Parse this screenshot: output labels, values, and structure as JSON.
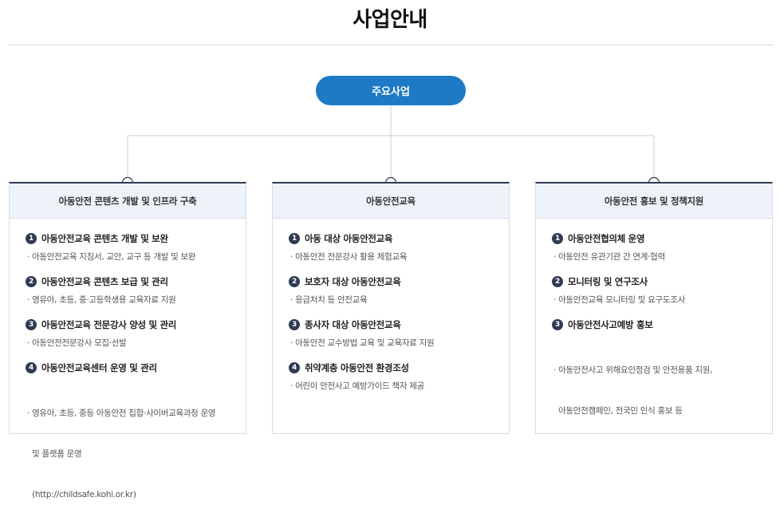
{
  "page": {
    "title": "사업안내"
  },
  "main": {
    "label": "주요사업"
  },
  "columns": [
    {
      "title": "아동안전 콘텐츠 개발 및 인프라 구축",
      "items": [
        {
          "num": "1",
          "title": "아동안전교육 콘텐츠 개발 및 보완",
          "desc": [
            "· 아동안전교육 지침서, 교안, 교구 등 개발 및 보완"
          ]
        },
        {
          "num": "2",
          "title": "아동안전교육 콘텐츠 보급 및 관리",
          "desc": [
            "· 영유아, 초등, 중·고등학생용 교육자료 지원"
          ]
        },
        {
          "num": "3",
          "title": "아동안전교육 전문강사 양성 및 관리",
          "desc": [
            "· 아동안전전문강사 모집·선발"
          ]
        },
        {
          "num": "4",
          "title": "아동안전교육센터 운영 및 관리",
          "desc": [
            "· 영유아, 초등, 중등 아동안전 집합·사이버교육과정 운영",
            "  및 플랫폼 운영",
            "  (http://childsafe.kohi.or.kr)"
          ]
        }
      ]
    },
    {
      "title": "아동안전교육",
      "items": [
        {
          "num": "1",
          "title": "아동 대상 아동안전교육",
          "desc": [
            "· 아동안전 전문강사 활용 체험교육"
          ]
        },
        {
          "num": "2",
          "title": "보호자 대상 아동안전교육",
          "desc": [
            "· 응급처치 등 안전교육"
          ]
        },
        {
          "num": "3",
          "title": "종사자 대상 아동안전교육",
          "desc": [
            "· 아동안전 교수방법 교육 및 교육자료 지원"
          ]
        },
        {
          "num": "4",
          "title": "취약계층 아동안전 환경조성",
          "desc": [
            "· 어린이 안전사고 예방가이드 책자 제공"
          ]
        }
      ]
    },
    {
      "title": "아동안전 홍보 및 정책지원",
      "items": [
        {
          "num": "1",
          "title": "아동안전협의체 운영",
          "desc": [
            "· 아동안전 유관기관 간 연계·협력"
          ]
        },
        {
          "num": "2",
          "title": "모니터링 및 연구조사",
          "desc": [
            "· 아동안전교육 모니터링 및 요구도조사"
          ]
        },
        {
          "num": "3",
          "title": "아동안전사고예방 홍보",
          "desc": [
            "· 아동안전사고 위해요인점검 및 안전용품 지원,",
            "  아동안전캠페인, 전국민 인식 홍보 등"
          ]
        }
      ]
    }
  ]
}
